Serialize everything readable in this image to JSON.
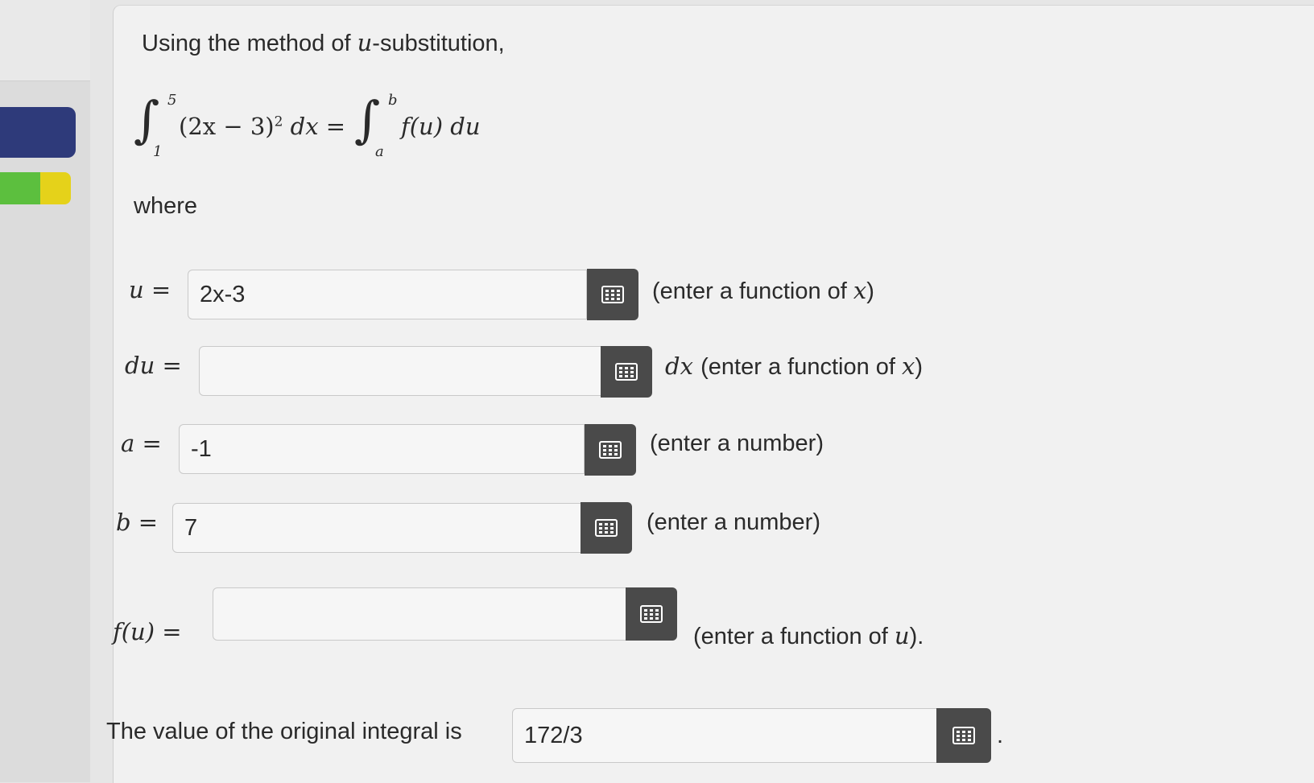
{
  "intro_prefix": "Using the method of ",
  "intro_var": "u",
  "intro_suffix": "-substitution,",
  "equation": {
    "left_upper": "5",
    "left_lower": "1",
    "left_integrand": "(2x − 3)",
    "left_exponent": "2",
    "left_differential": "dx =",
    "right_upper": "b",
    "right_lower": "a",
    "right_integrand": "f(u) du"
  },
  "where_label": "where",
  "fields": [
    {
      "label": "u =",
      "value": "2x-3",
      "hint_pre": "",
      "hint": "(enter a function of ",
      "hint_var": "x",
      "hint_end": ")"
    },
    {
      "label": "du =",
      "value": "",
      "hint_pre": "dx ",
      "hint": "(enter a function of ",
      "hint_var": "x",
      "hint_end": ")"
    },
    {
      "label": "a =",
      "value": "-1",
      "hint_pre": "",
      "hint": "(enter a number)",
      "hint_var": "",
      "hint_end": ""
    },
    {
      "label": "b =",
      "value": "7",
      "hint_pre": "",
      "hint": "(enter a number)",
      "hint_var": "",
      "hint_end": ""
    },
    {
      "label": "f(u) =",
      "value": "",
      "hint_pre": "",
      "hint": "(enter a function of ",
      "hint_var": "u",
      "hint_end": ")."
    }
  ],
  "result": {
    "label": "The value of the original integral is",
    "value": "172/3",
    "end": "."
  },
  "icons": {
    "keypad": "keypad-grid-icon"
  }
}
